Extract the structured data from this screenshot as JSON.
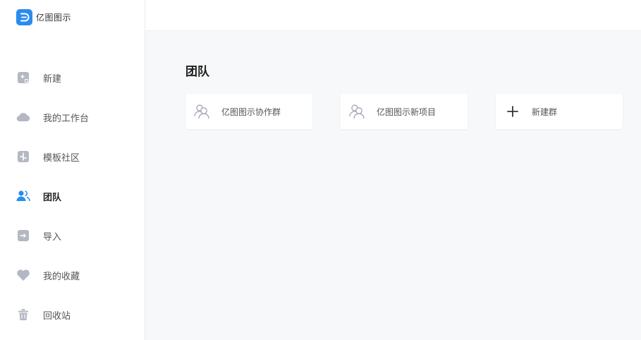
{
  "brand": {
    "name": "亿图图示",
    "logo_icon": "edraw-logo-icon",
    "accent_color": "#2a8cf0"
  },
  "sidebar": {
    "items": [
      {
        "label": "新建",
        "icon": "new-file-icon",
        "active": false
      },
      {
        "label": "我的工作台",
        "icon": "cloud-icon",
        "active": false
      },
      {
        "label": "模板社区",
        "icon": "template-icon",
        "active": false
      },
      {
        "label": "团队",
        "icon": "team-icon",
        "active": true
      },
      {
        "label": "导入",
        "icon": "import-icon",
        "active": false
      },
      {
        "label": "我的收藏",
        "icon": "heart-icon",
        "active": false
      },
      {
        "label": "回收站",
        "icon": "trash-icon",
        "active": false
      }
    ]
  },
  "main": {
    "title": "团队",
    "cards": [
      {
        "label": "亿图图示协作群",
        "icon": "group-icon"
      },
      {
        "label": "亿图图示新项目",
        "icon": "group-icon"
      },
      {
        "label": "新建群",
        "icon": "plus-icon"
      }
    ]
  },
  "colors": {
    "active_icon": "#2a8cf0",
    "inactive_icon": "#b3b8c2"
  }
}
